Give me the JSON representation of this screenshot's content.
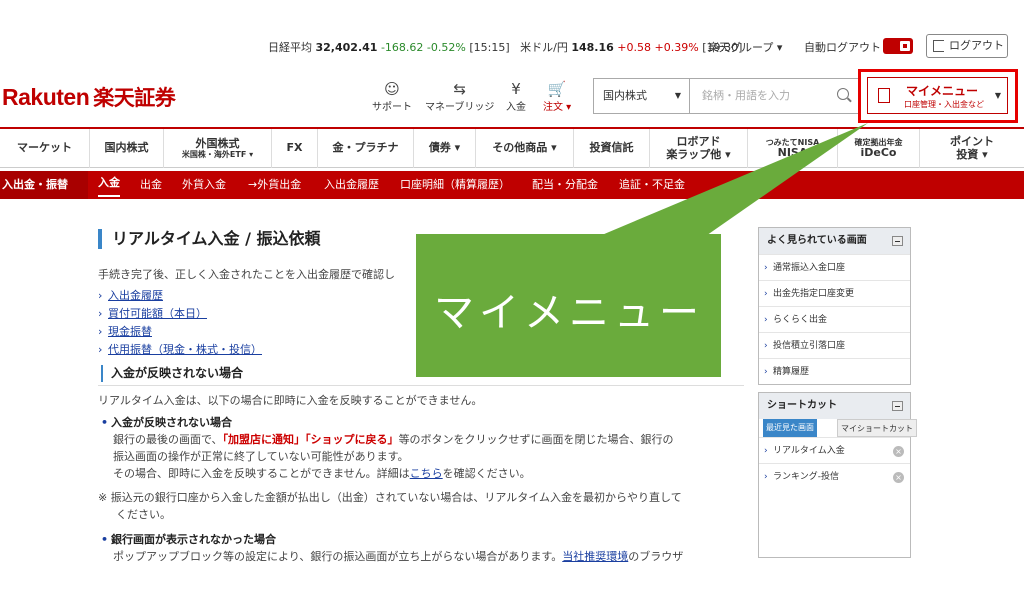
{
  "topbar": {
    "nikkei_label": "日経平均",
    "nikkei_value": "32,402.41",
    "nikkei_change": "-168.62",
    "nikkei_pct": "-0.52%",
    "nikkei_time": "[15:15]",
    "usdjpy_label": "米ドル/円",
    "usdjpy_value": "148.16",
    "usdjpy_change": "+0.58",
    "usdjpy_pct": "+0.39%",
    "usdjpy_time": "[19:30]",
    "group_label": "楽天グループ ▾",
    "auto_logout_label": "自動ログアウト",
    "logout_label": "ログアウト"
  },
  "header": {
    "logo_en": "Rakuten",
    "logo_jp": "楽天証券",
    "icons": [
      {
        "label": "サポート",
        "glyph": "☺"
      },
      {
        "label": "マネーブリッジ",
        "glyph": "⇆"
      },
      {
        "label": "入金",
        "glyph": "¥"
      },
      {
        "label": "注文 ▾",
        "glyph": "🛒"
      }
    ],
    "search_category": "国内株式",
    "search_placeholder": "銘柄・用語を入力",
    "mymenu_title": "マイメニュー",
    "mymenu_sub": "口座管理・入出金など"
  },
  "mainnav": [
    {
      "label": "マーケット",
      "sub": ""
    },
    {
      "label": "国内株式",
      "sub": ""
    },
    {
      "label": "外国株式",
      "sub": "米国株・海外ETF ▾"
    },
    {
      "label": "FX",
      "sub": ""
    },
    {
      "label": "金・プラチナ",
      "sub": ""
    },
    {
      "label": "債券 ▾",
      "sub": ""
    },
    {
      "label": "その他商品 ▾",
      "sub": ""
    },
    {
      "label": "投資信託",
      "sub": ""
    },
    {
      "label": "ロボアド",
      "sub": "楽ラップ他 ▾"
    },
    {
      "label": "つみたてNISA",
      "sub": "NISA"
    },
    {
      "label": "確定拠出年金",
      "sub": "iDeCo"
    },
    {
      "label": "ポイント",
      "sub": "投資 ▾"
    }
  ],
  "subnav": {
    "current": "入出金・振替",
    "items": [
      "入金",
      "出金",
      "外貨入金",
      "→外貨出金",
      "入出金履歴",
      "口座明細（精算履歴）",
      "配当・分配金",
      "追証・不足金"
    ]
  },
  "main": {
    "title": "リアルタイム入金 / 振込依頼",
    "intro": "手続き完了後、正しく入金されたことを入出金履歴で確認し",
    "links": [
      "入出金履歴",
      "買付可能額（本日）",
      "現金振替",
      "代用振替（現金・株式・投信）"
    ],
    "section_title": "入金が反映されない場合",
    "para1": "リアルタイム入金は、以下の場合に即時に入金を反映することができません。",
    "bullet1": "入金が反映されない場合",
    "b1_line1_a": "銀行の最後の画面で、",
    "b1_line1_red1": "「加盟店に通知」",
    "b1_line1_red2": "「ショップに戻る」",
    "b1_line1_b": "等のボタンをクリックせずに画面を閉じた場合、銀行の",
    "b1_line2": "振込画面の操作が正常に終了していない可能性があります。",
    "b1_line3_a": "その場合、即時に入金を反映することができません。詳細は",
    "b1_line3_link": "こちら",
    "b1_line3_b": "を確認ください。",
    "note_line1": "※ 振込元の銀行口座から入金した金額が払出し（出金）されていない場合は、リアルタイム入金を最初からやり直して",
    "note_line2": "ください。",
    "bullet2": "銀行画面が表示されなかった場合",
    "b2_line1_a": "ポップアップブロック等の設定により、銀行の振込画面が立ち上がらない場合があります。",
    "b2_line1_link": "当社推奨環境",
    "b2_line1_b": "のブラウザ"
  },
  "sidebar": {
    "popular_title": "よく見られている画面",
    "popular_items": [
      "通常振込入金口座",
      "出金先指定口座変更",
      "らくらく出金",
      "投信積立引落口座",
      "精算履歴"
    ],
    "shortcut_title": "ショートカット",
    "tab_recent": "最近見た画面",
    "tab_my": "マイショートカット",
    "recent_items": [
      "リアルタイム入金",
      "ランキング-投信"
    ]
  },
  "callout": {
    "text": "マイメニュー",
    "color": "#6aab3c"
  },
  "colors": {
    "brand": "#bf0000",
    "highlight": "#e60000",
    "link": "#1a3fa0"
  }
}
